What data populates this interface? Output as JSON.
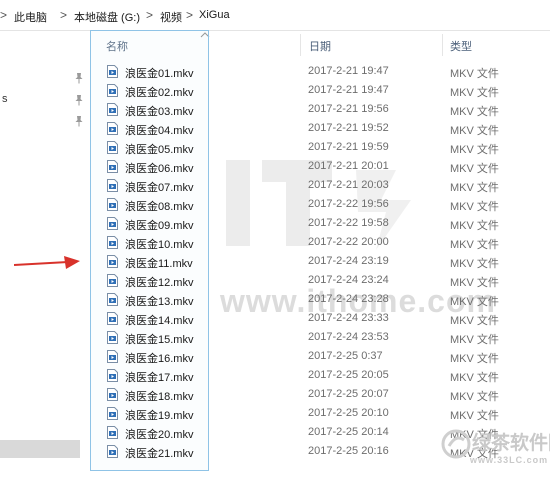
{
  "breadcrumb": {
    "items": [
      "此电脑",
      "本地磁盘 (G:)",
      "视频",
      "XiGua"
    ],
    "separator": ">"
  },
  "nav": {
    "fragment_text": "s"
  },
  "columns": {
    "name": "名称",
    "date": "日期",
    "type": "类型"
  },
  "files": [
    {
      "name": "浪医金01.mkv",
      "date": "2017-2-21 19:47",
      "type": "MKV 文件"
    },
    {
      "name": "浪医金02.mkv",
      "date": "2017-2-21 19:47",
      "type": "MKV 文件"
    },
    {
      "name": "浪医金03.mkv",
      "date": "2017-2-21 19:56",
      "type": "MKV 文件"
    },
    {
      "name": "浪医金04.mkv",
      "date": "2017-2-21 19:52",
      "type": "MKV 文件"
    },
    {
      "name": "浪医金05.mkv",
      "date": "2017-2-21 19:59",
      "type": "MKV 文件"
    },
    {
      "name": "浪医金06.mkv",
      "date": "2017-2-21 20:01",
      "type": "MKV 文件"
    },
    {
      "name": "浪医金07.mkv",
      "date": "2017-2-21 20:03",
      "type": "MKV 文件"
    },
    {
      "name": "浪医金08.mkv",
      "date": "2017-2-22 19:56",
      "type": "MKV 文件"
    },
    {
      "name": "浪医金09.mkv",
      "date": "2017-2-22 19:58",
      "type": "MKV 文件"
    },
    {
      "name": "浪医金10.mkv",
      "date": "2017-2-22 20:00",
      "type": "MKV 文件"
    },
    {
      "name": "浪医金11.mkv",
      "date": "2017-2-24 23:19",
      "type": "MKV 文件"
    },
    {
      "name": "浪医金12.mkv",
      "date": "2017-2-24 23:24",
      "type": "MKV 文件"
    },
    {
      "name": "浪医金13.mkv",
      "date": "2017-2-24 23:28",
      "type": "MKV 文件"
    },
    {
      "name": "浪医金14.mkv",
      "date": "2017-2-24 23:33",
      "type": "MKV 文件"
    },
    {
      "name": "浪医金15.mkv",
      "date": "2017-2-24 23:53",
      "type": "MKV 文件"
    },
    {
      "name": "浪医金16.mkv",
      "date": "2017-2-25 0:37",
      "type": "MKV 文件"
    },
    {
      "name": "浪医金17.mkv",
      "date": "2017-2-25 20:05",
      "type": "MKV 文件"
    },
    {
      "name": "浪医金18.mkv",
      "date": "2017-2-25 20:07",
      "type": "MKV 文件"
    },
    {
      "name": "浪医金19.mkv",
      "date": "2017-2-25 20:10",
      "type": "MKV 文件"
    },
    {
      "name": "浪医金20.mkv",
      "date": "2017-2-25 20:14",
      "type": "MKV 文件"
    },
    {
      "name": "浪医金21.mkv",
      "date": "2017-2-25 20:16",
      "type": "MKV 文件"
    }
  ],
  "watermark": {
    "site": "www.ithome.com",
    "corner_brand": "绿茶软件园",
    "corner_url": "www.33LC.com"
  },
  "colors": {
    "selection_border": "#8fc3e6",
    "arrow": "#d8322b",
    "header_text": "#4c607a",
    "file_icon_accent": "#2f6fb6"
  },
  "icons": {
    "file": "video-file-icon",
    "pin": "pin-icon",
    "arrow": "red-arrow-annotation",
    "sort": "chevron-up-icon"
  }
}
